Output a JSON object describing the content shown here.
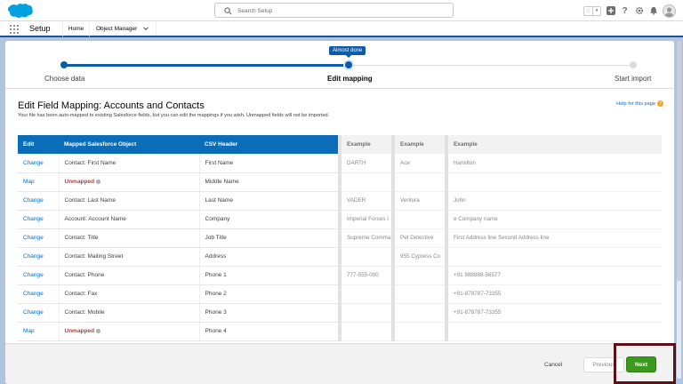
{
  "header": {
    "search_placeholder": "Search Setup",
    "help_glyph": "?"
  },
  "nav": {
    "app_name": "Setup",
    "tabs": [
      {
        "label": "Home"
      },
      {
        "label": "Object Manager"
      }
    ]
  },
  "progress": {
    "tooltip": "Almost done",
    "steps": [
      {
        "label": "Choose data",
        "state": "complete"
      },
      {
        "label": "Edit mapping",
        "state": "current"
      },
      {
        "label": "Start import",
        "state": "incomplete"
      }
    ]
  },
  "page": {
    "title": "Edit Field Mapping: Accounts and Contacts",
    "subtitle": "Your file has been auto-mapped to existing Salesforce fields, but you can edit the mappings if you wish. Unmapped fields will not be imported.",
    "help_link": "Help for this page"
  },
  "mapping_table": {
    "headers": [
      "Edit",
      "Mapped Salesforce Object",
      "CSV Header"
    ],
    "rows": [
      {
        "action": "Change",
        "object": "Contact: First Name",
        "csv": "First Name"
      },
      {
        "action": "Map",
        "object": "Unmapped",
        "csv": "Middle Name"
      },
      {
        "action": "Change",
        "object": "Contact: Last Name",
        "csv": "Last Name"
      },
      {
        "action": "Change",
        "object": "Account: Account Name",
        "csv": "Company"
      },
      {
        "action": "Change",
        "object": "Contact: Title",
        "csv": "Job Title"
      },
      {
        "action": "Change",
        "object": "Contact: Mailing Street",
        "csv": "Address"
      },
      {
        "action": "Change",
        "object": "Contact: Phone",
        "csv": "Phone 1"
      },
      {
        "action": "Change",
        "object": "Contact: Fax",
        "csv": "Phone 2"
      },
      {
        "action": "Change",
        "object": "Contact: Mobile",
        "csv": "Phone 3"
      },
      {
        "action": "Map",
        "object": "Unmapped",
        "csv": "Phone 4"
      }
    ]
  },
  "example_table": {
    "headers": [
      "Example",
      "Example",
      "Example"
    ],
    "rows": [
      [
        "DARTH",
        "Ace",
        "Hamilton"
      ],
      [
        "",
        "",
        ""
      ],
      [
        "VADER",
        "Ventura",
        "John"
      ],
      [
        "Imperial Forces I",
        "",
        "e Company name"
      ],
      [
        "Supreme Comma",
        "Pet Detective",
        "First Address line Second Address line"
      ],
      [
        "",
        "955 Cypress Co",
        ""
      ],
      [
        "777-555-000",
        "",
        "+91 988888-56577"
      ],
      [
        "",
        "",
        "+91-878787-73355"
      ],
      [
        "",
        "",
        "+91-878787-73355"
      ],
      [
        "",
        "",
        ""
      ]
    ]
  },
  "footer": {
    "cancel": "Cancel",
    "previous": "Previous",
    "next": "Next"
  },
  "colors": {
    "brand_blue": "#0b6cb8",
    "progress_blue": "#0b5ba8",
    "unmapped_red": "#c23934",
    "next_green": "#3b9a1e",
    "highlight_box": "#5e1019"
  }
}
